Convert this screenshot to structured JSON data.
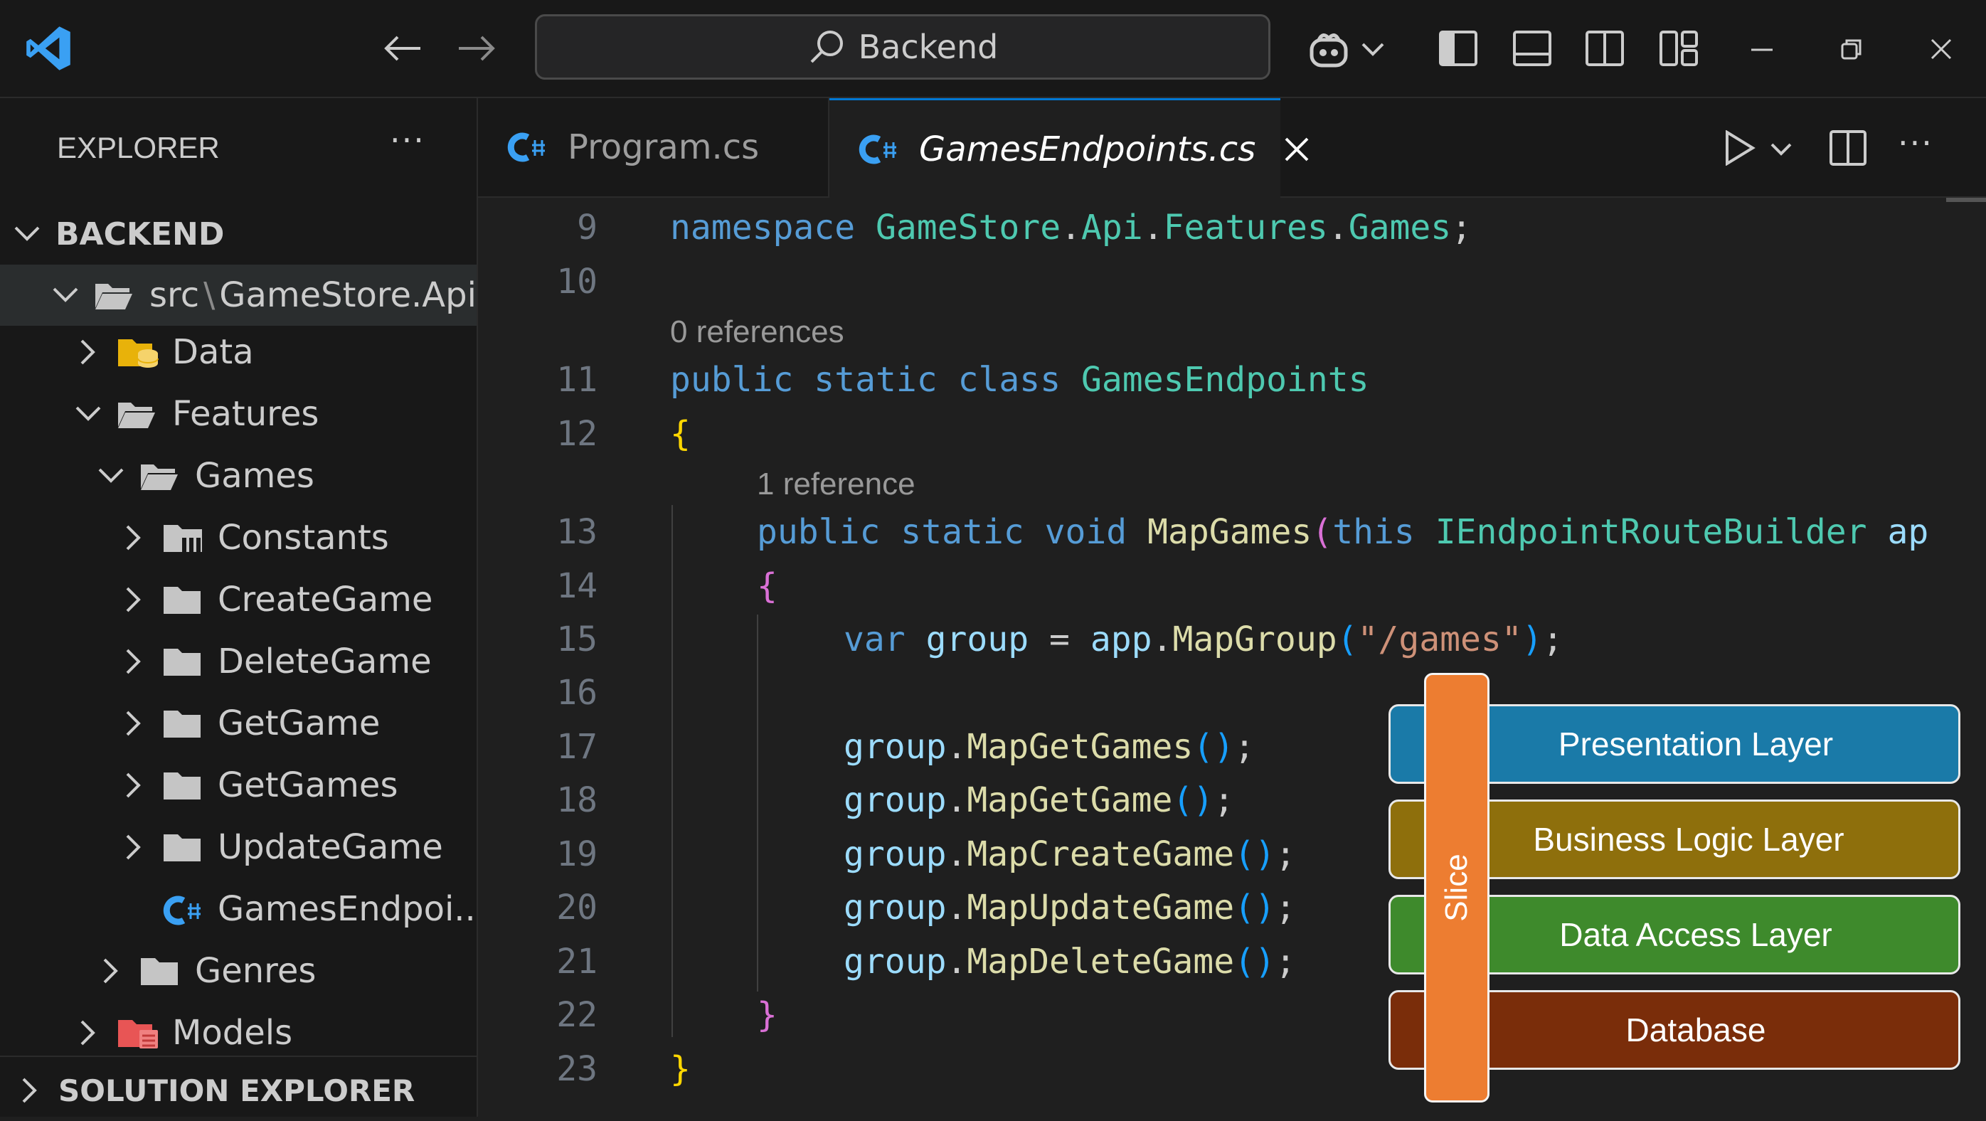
{
  "titlebar": {
    "search_text": "Backend"
  },
  "sidebar": {
    "header": "EXPLORER",
    "more": "···",
    "section": "BACKEND",
    "tree": [
      {
        "label": "src",
        "sep": "\\",
        "label2": "GameStore.Api"
      },
      {
        "label": "Data"
      },
      {
        "label": "Features"
      },
      {
        "label": "Games"
      },
      {
        "label": "Constants"
      },
      {
        "label": "CreateGame"
      },
      {
        "label": "DeleteGame"
      },
      {
        "label": "GetGame"
      },
      {
        "label": "GetGames"
      },
      {
        "label": "UpdateGame"
      },
      {
        "label": "GamesEndpoi..."
      },
      {
        "label": "Genres"
      },
      {
        "label": "Models"
      }
    ],
    "footer": "SOLUTION EXPLORER"
  },
  "tabs": [
    {
      "label": "Program.cs",
      "active": false
    },
    {
      "label": "GamesEndpoints.cs",
      "active": true
    }
  ],
  "editor": {
    "line_numbers": [
      "9",
      "10",
      "11",
      "12",
      "13",
      "14",
      "15",
      "16",
      "17",
      "18",
      "19",
      "20",
      "21",
      "22",
      "23"
    ],
    "lens_0": "0 references",
    "lens_1": "1 reference",
    "t": {
      "namespace": "namespace",
      "ns1": "GameStore",
      "ns2": "Api",
      "ns3": "Features",
      "ns4": "Games",
      "dot": ".",
      "semi": ";",
      "public": "public",
      "static": "static",
      "class": "class",
      "classname": "GamesEndpoints",
      "lbrace": "{",
      "rbrace": "}",
      "void": "void",
      "mapgames": "MapGames",
      "lparen": "(",
      "rparen": ")",
      "this": "this",
      "iface": "IEndpointRouteBuilder",
      "ap": "ap",
      "var": "var",
      "group": "group",
      "eq": "=",
      "app": "app",
      "mapgroup": "MapGroup",
      "route": "\"/games\"",
      "m1": "MapGetGames",
      "m2": "MapGetGame",
      "m3": "MapCreateGame",
      "m4": "MapUpdateGame",
      "m5": "MapDeleteGame",
      "parens": "()"
    }
  },
  "diagram": {
    "slice": "Slice",
    "layers": [
      {
        "label": "Presentation Layer",
        "color": "#1a7aa8"
      },
      {
        "label": "Business Logic Layer",
        "color": "#8e6f0c"
      },
      {
        "label": "Data Access Layer",
        "color": "#3e8a2c"
      },
      {
        "label": "Database",
        "color": "#7a2d0a"
      }
    ],
    "slice_color": "#ed7d31"
  }
}
